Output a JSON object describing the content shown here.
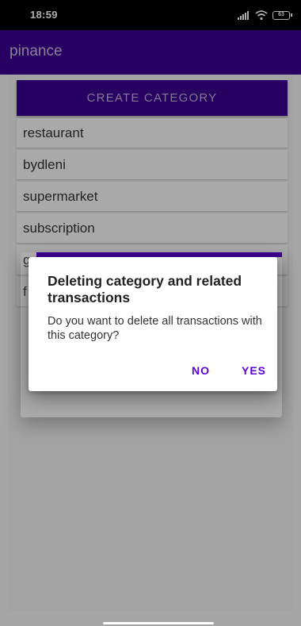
{
  "status_bar": {
    "time": "18:59",
    "battery": "63"
  },
  "app_bar": {
    "title": "pinance"
  },
  "content": {
    "create_button_label": "CREATE CATEGORY",
    "categories": [
      {
        "name": "restaurant"
      },
      {
        "name": "bydleni"
      },
      {
        "name": "supermarket"
      },
      {
        "name": "subscription"
      },
      {
        "name": "g"
      },
      {
        "name": "f"
      }
    ]
  },
  "dialog": {
    "title": "Deleting category and related transactions",
    "message": "Do you want to delete all transactions with this category?",
    "no_label": "NO",
    "yes_label": "YES"
  },
  "colors": {
    "primary": "#3a008f",
    "accent": "#5a00d6"
  }
}
